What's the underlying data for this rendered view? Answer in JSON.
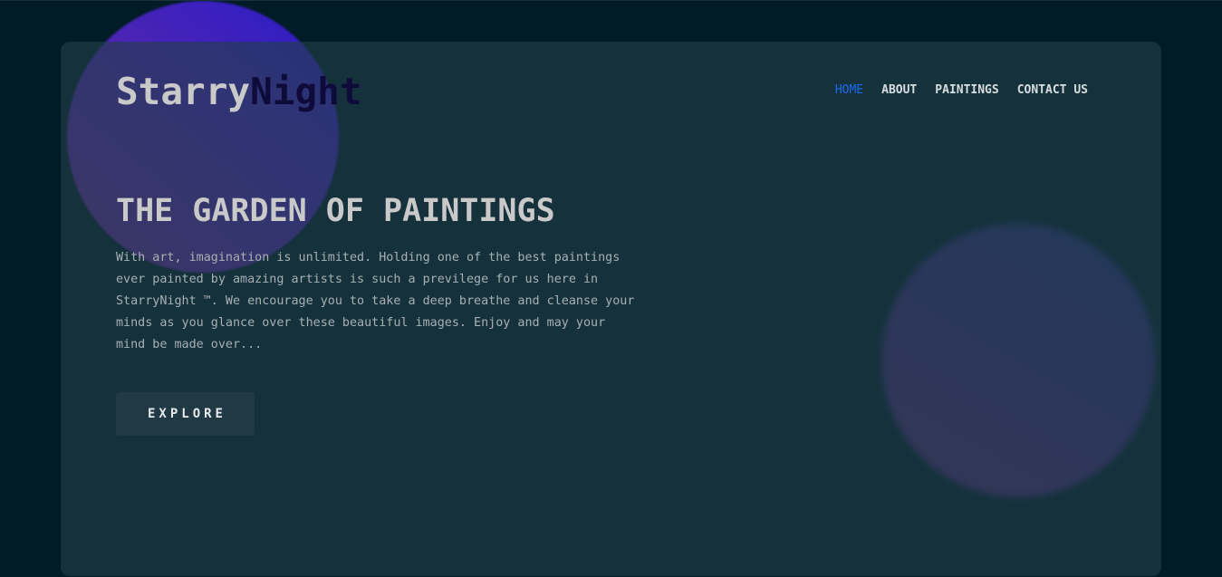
{
  "brand": {
    "part1": "Starry",
    "part2": "Night",
    "part1_color": "#c9c9c9",
    "part2_color": "#0e0b3a"
  },
  "nav": {
    "items": [
      {
        "label": "HOME",
        "active": true
      },
      {
        "label": "ABOUT",
        "active": false
      },
      {
        "label": "PAINTINGS",
        "active": false
      },
      {
        "label": "CONTACT US",
        "active": false
      }
    ],
    "active_color": "#1a6cf0"
  },
  "hero": {
    "title": "THE GARDEN OF PAINTINGS",
    "description": "With art, imagination is unlimited. Holding one of the best paintings ever painted by amazing artists is such a previlege for us here in StarryNight ™. We encourage you to take a deep breathe and cleanse your minds as you glance over these beautiful images. Enjoy and may your mind be made over...",
    "button_label": "EXPLORE"
  },
  "colors": {
    "background": "#011c26",
    "card": "#163039",
    "button": "#203945"
  }
}
